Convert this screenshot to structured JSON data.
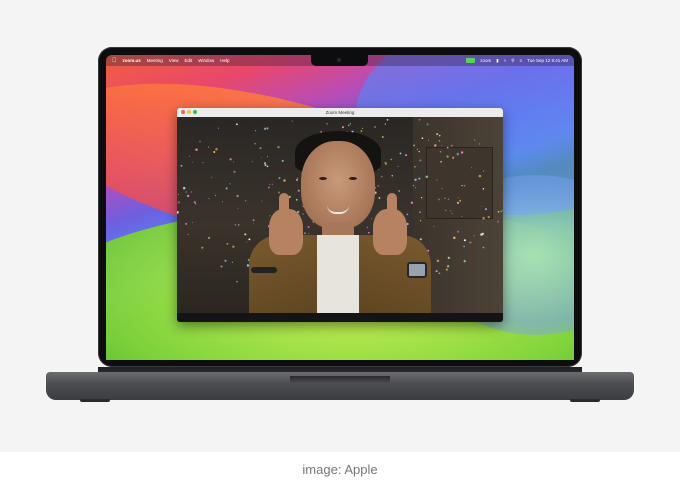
{
  "menubar": {
    "app_name": "zoom.us",
    "items": [
      "Meeting",
      "View",
      "Edit",
      "Window",
      "Help"
    ],
    "status_zoom": "zoom",
    "clock": "Tue Sep 12  9:41 AM"
  },
  "zoom_window": {
    "title": "Zoom Meeting"
  },
  "caption": "image: Apple",
  "colors": {
    "zoom_badge": "#5ad25a",
    "close": "#ff5f57",
    "minimize": "#febc2e",
    "zoom": "#28c840"
  }
}
